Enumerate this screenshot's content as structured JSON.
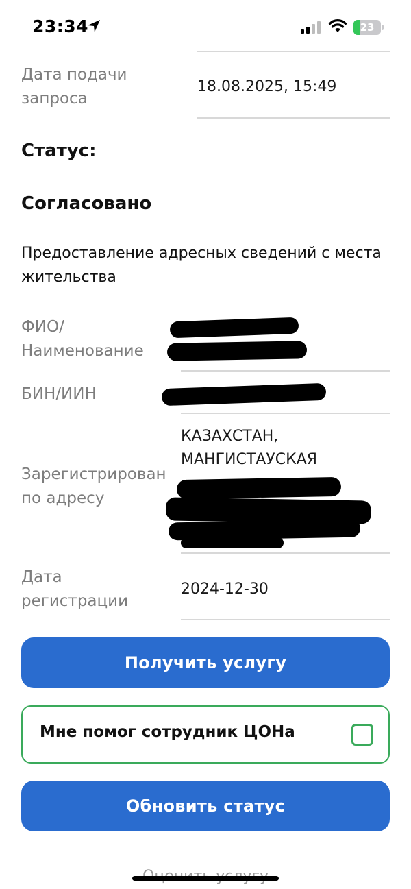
{
  "status_bar": {
    "time": "23:34",
    "battery": "23",
    "battery_level": 0.23,
    "battery_color": "#34c759"
  },
  "request": {
    "date_label": "Дата подачи запроса",
    "date_value": "18.08.2025, 15:49"
  },
  "status": {
    "heading": "Статус:",
    "value": "Согласовано",
    "description": "Предоставление адресных сведений с места жительства"
  },
  "details": {
    "fio_label": "ФИО/ Наименование",
    "bin_label": "БИН/ИИН",
    "address_label": "Зарегистрирован по адресу",
    "address_visible": "КАЗАХСТАН, МАНГИСТАУСКАЯ",
    "reg_date_label": "Дата регистрации",
    "reg_date_value": "2024-12-30"
  },
  "actions": {
    "get_service": "Получить услугу",
    "helped_by_staff": "Мне помог сотрудник ЦОНа",
    "refresh_status": "Обновить статус",
    "rate_service": "Оценить услугу"
  },
  "colors": {
    "primary": "#2a6ccf",
    "success": "#3aaa5b"
  },
  "icons": {
    "location": "location-arrow-icon",
    "signal": "cellular-signal-icon",
    "wifi": "wifi-icon",
    "checkbox": "checkbox-icon"
  }
}
